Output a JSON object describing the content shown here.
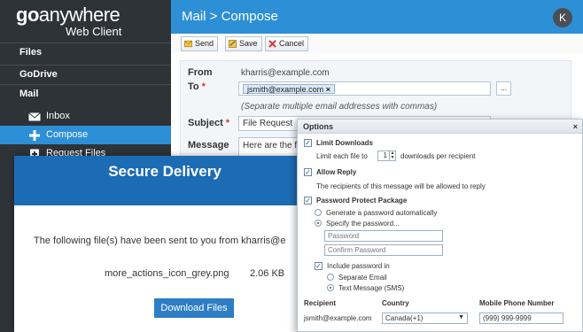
{
  "brand": {
    "logo_bold": "go",
    "logo_rest": "anywhere",
    "subtitle": "Web Client"
  },
  "sidebar": {
    "sections": [
      {
        "label": "Files"
      },
      {
        "label": "GoDrive"
      },
      {
        "label": "Mail"
      }
    ],
    "items": [
      {
        "label": "Inbox",
        "icon": "envelope-icon"
      },
      {
        "label": "Compose",
        "icon": "plus-icon",
        "active": true
      },
      {
        "label": "Request Files",
        "icon": "request-icon"
      }
    ]
  },
  "header": {
    "title": "Mail > Compose",
    "avatar_initial": "K"
  },
  "toolbar": {
    "send": "Send",
    "save": "Save",
    "cancel": "Cancel"
  },
  "compose": {
    "from_label": "From",
    "from_value": "kharris@example.com",
    "to_label": "To",
    "to_chip": "jsmith@example.com",
    "to_chip_remove": "×",
    "more_button": "...",
    "to_hint": "(Separate multiple email addresses with commas)",
    "subject_label": "Subject",
    "subject_value": "File Request",
    "message_label": "Message",
    "message_value": "Here are the fil"
  },
  "delivery": {
    "title": "Secure Delivery",
    "text": "The following file(s) have been sent to you from kharris@e",
    "file_name": "more_actions_icon_grey.png",
    "file_size": "2.06 KB",
    "download_button": "Download Files"
  },
  "options": {
    "title": "Options",
    "close": "×",
    "limit_downloads": "Limit Downloads",
    "limit_prefix": "Limit each file to",
    "limit_value": "1",
    "limit_suffix": "downloads per recipient",
    "allow_reply": "Allow Reply",
    "allow_reply_desc": "The recipients of this message will be allowed to reply",
    "password_protect": "Password Protect Package",
    "generate_password": "Generate a password automatically",
    "specify_password": "Specify the password...",
    "password_placeholder": "Password",
    "confirm_placeholder": "Confirm Password",
    "include_password": "Include password in",
    "separate_email": "Separate Email",
    "text_message": "Text Message (SMS)",
    "col_recipient": "Recipient",
    "col_country": "Country",
    "col_phone": "Mobile Phone Number",
    "row_recipient": "jsmith@example.com",
    "row_country": "Canada(+1)",
    "row_phone": "(999) 999-9999"
  },
  "colors": {
    "accent": "#2d8fd5",
    "sidebar": "#2e3338",
    "delivery_header": "#1c6cb5",
    "required": "#d9342b"
  }
}
